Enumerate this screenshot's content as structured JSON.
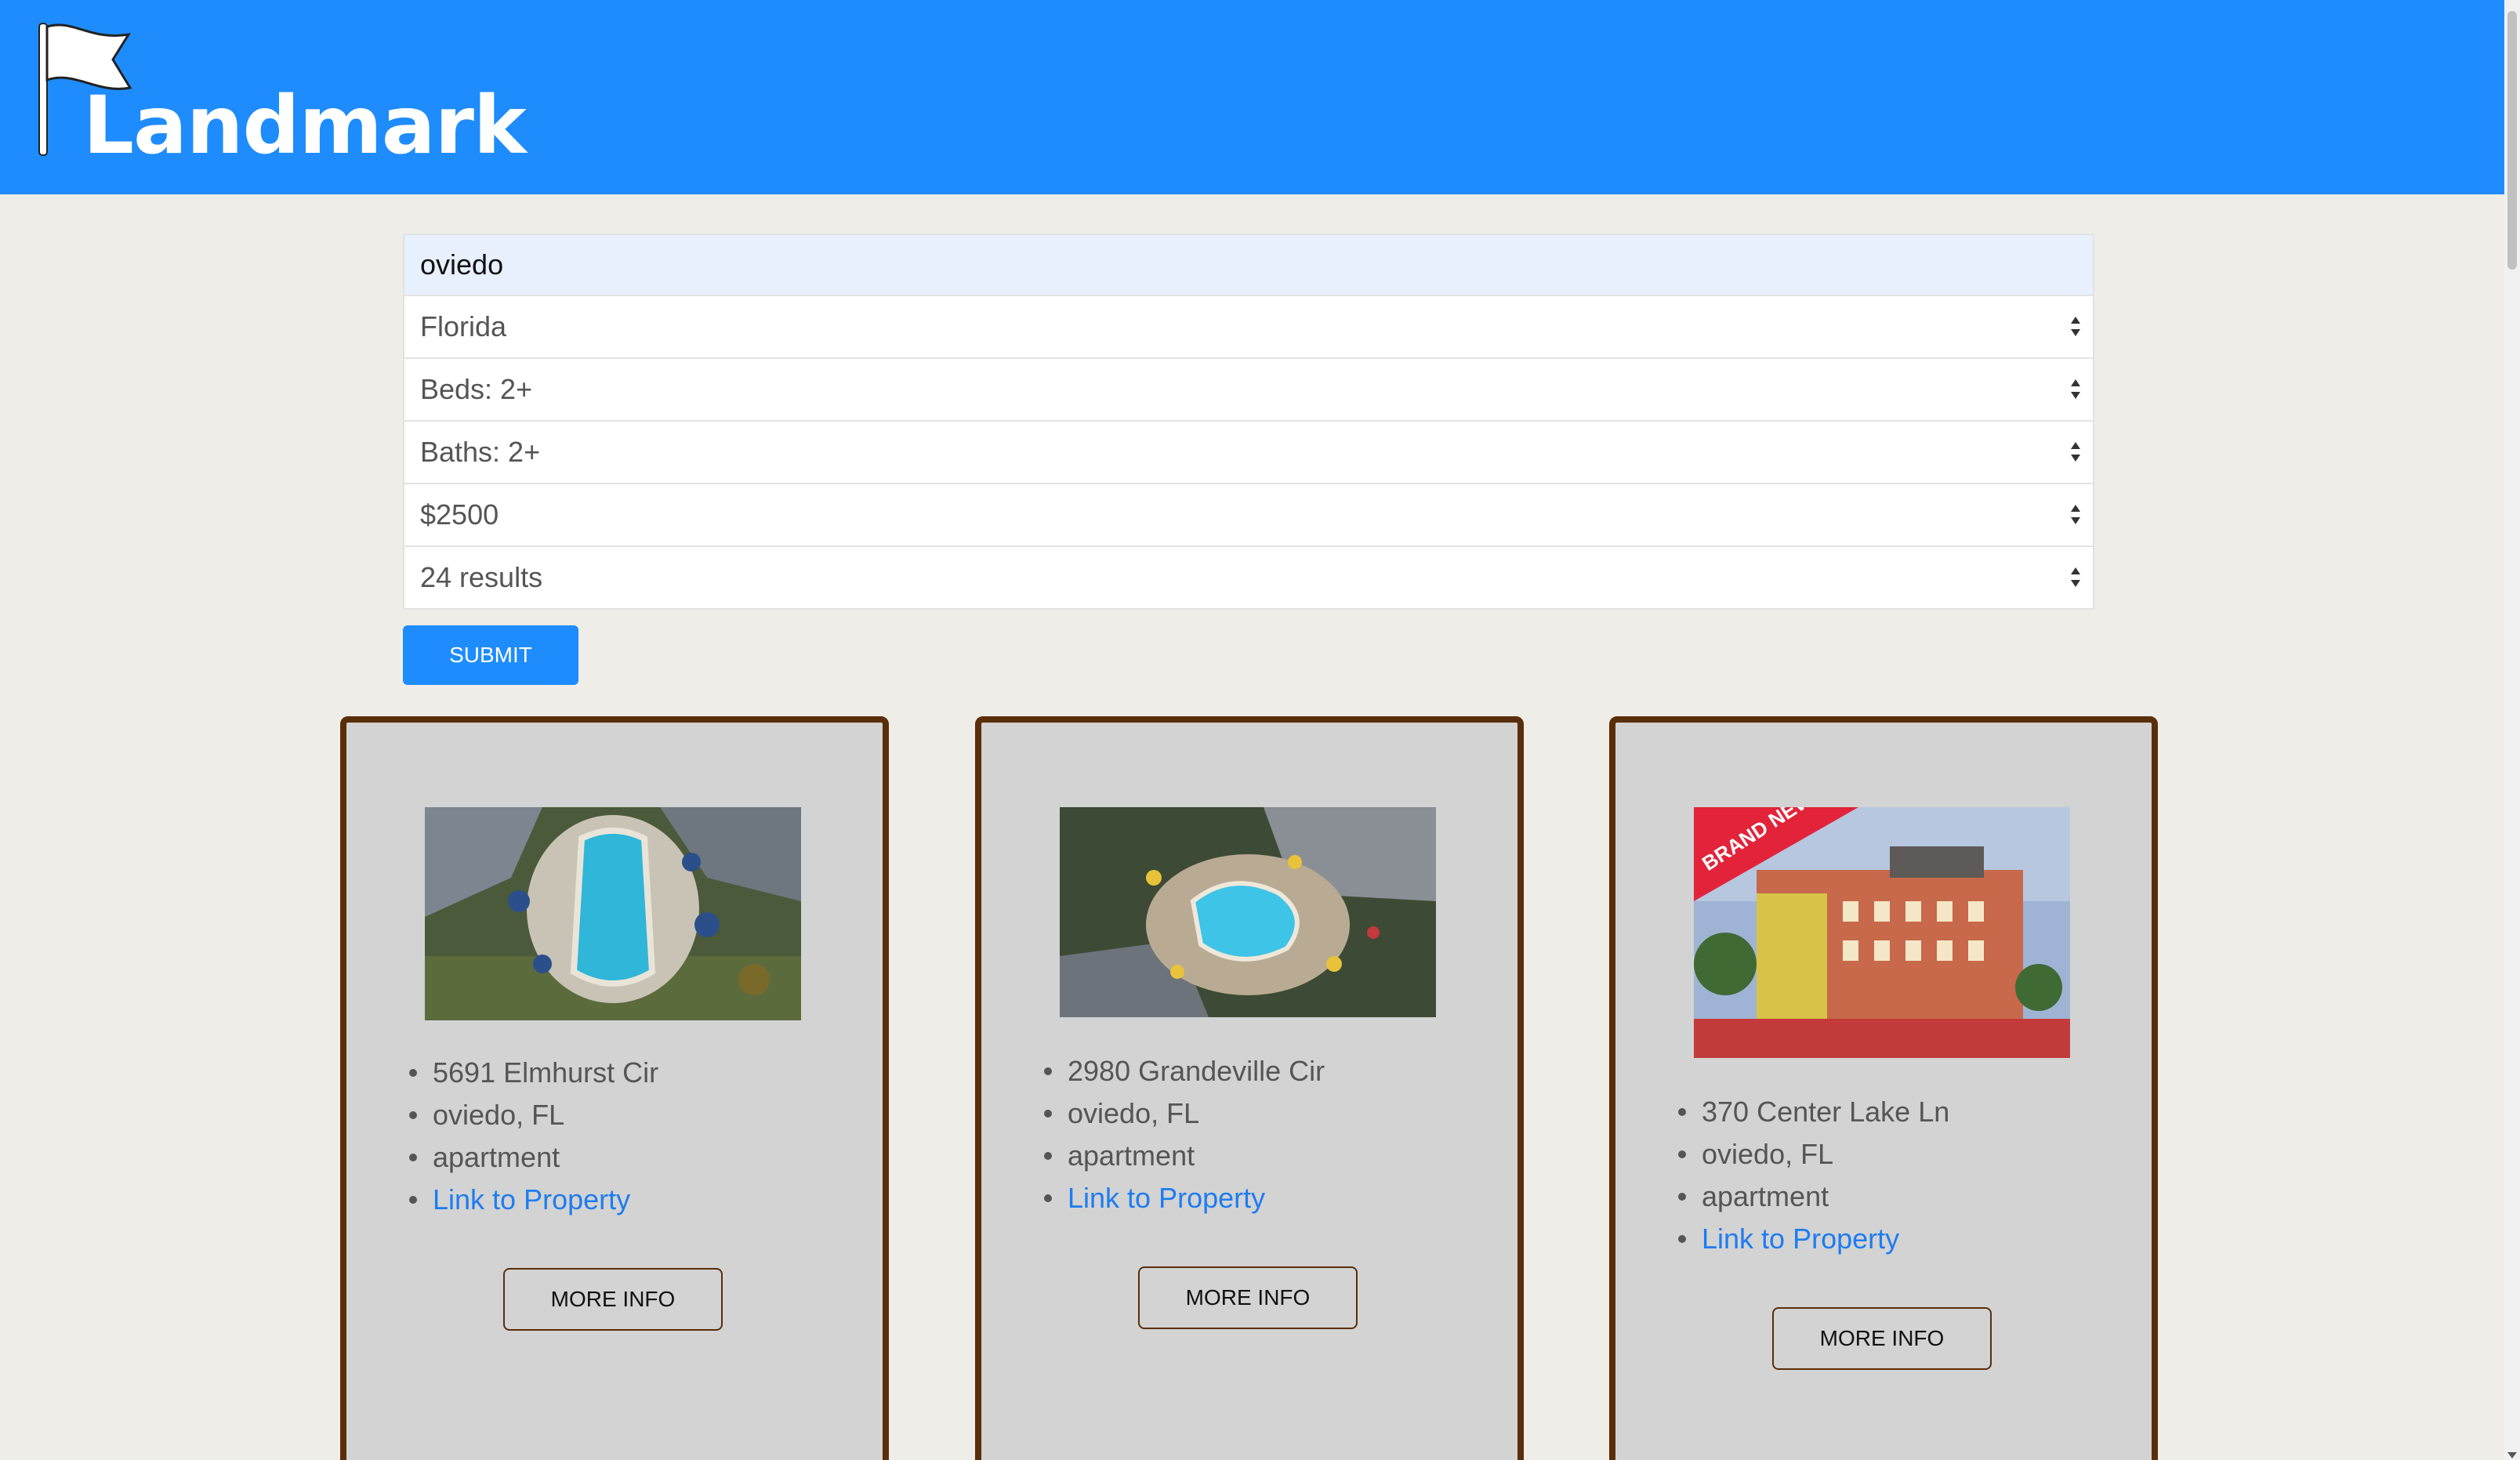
{
  "header": {
    "logo_text": "Landmark",
    "bg_color": "#1e8cfc",
    "logo_icon": "flag-icon"
  },
  "search": {
    "city_value": "oviedo",
    "state_value": "Florida",
    "beds_value": "Beds: 2+",
    "baths_value": "Baths: 2+",
    "price_value": "$2500",
    "results_value": "24 results",
    "submit_label": "SUBMIT"
  },
  "listings": [
    {
      "address": "5691 Elmhurst Cir",
      "city": "oviedo, FL",
      "type": "apartment",
      "link_label": "Link to Property",
      "button_label": "MORE INFO"
    },
    {
      "address": "2980 Grandeville Cir",
      "city": "oviedo, FL",
      "type": "apartment",
      "link_label": "Link to Property",
      "button_label": "MORE INFO"
    },
    {
      "address": "370 Center Lake Ln",
      "city": "oviedo, FL",
      "type": "apartment",
      "link_label": "Link to Property",
      "button_label": "MORE INFO",
      "photo_badge": "BRAND NEW"
    }
  ],
  "colors": {
    "accent": "#1e8cfc",
    "card_border": "#5a2e0a",
    "card_bg": "#d3d3d3",
    "page_bg": "#efede8",
    "link": "#1e7cf0"
  }
}
